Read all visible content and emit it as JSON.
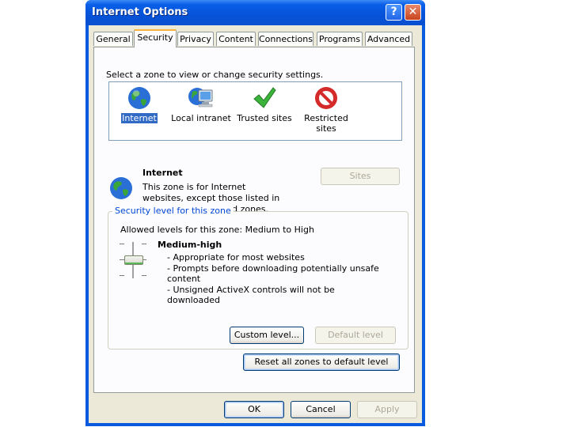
{
  "window": {
    "title": "Internet Options",
    "help_symbol": "?",
    "close_symbol": "✕"
  },
  "tabs": [
    {
      "label": "General"
    },
    {
      "label": "Security"
    },
    {
      "label": "Privacy"
    },
    {
      "label": "Content"
    },
    {
      "label": "Connections"
    },
    {
      "label": "Programs"
    },
    {
      "label": "Advanced"
    }
  ],
  "security": {
    "instruction": "Select a zone to view or change security settings.",
    "zones": [
      {
        "label": "Internet",
        "icon": "globe-icon",
        "selected": true
      },
      {
        "label": "Local intranet",
        "icon": "computer-globe-icon"
      },
      {
        "label": "Trusted sites",
        "icon": "checkmark-icon"
      },
      {
        "label": "Restricted sites",
        "icon": "no-entry-icon"
      }
    ],
    "zone_title": "Internet",
    "zone_description": "This zone is for Internet websites, except those listed in trusted and restricted zones.",
    "sites_button": "Sites",
    "level_group_label": "Security level for this zone",
    "allowed_levels": "Allowed levels for this zone: Medium to High",
    "level_name": "Medium-high",
    "level_bullets": [
      "- Appropriate for most websites",
      "- Prompts before downloading potentially unsafe content",
      "- Unsigned ActiveX controls will not be downloaded"
    ],
    "custom_level_button": "Custom level...",
    "default_level_button": "Default level",
    "reset_button": "Reset all zones to default level"
  },
  "footer": {
    "ok": "OK",
    "cancel": "Cancel",
    "apply": "Apply"
  },
  "colors": {
    "title_bar": "#0553d8",
    "selection": "#316ac5",
    "group_label": "#0046d5"
  }
}
